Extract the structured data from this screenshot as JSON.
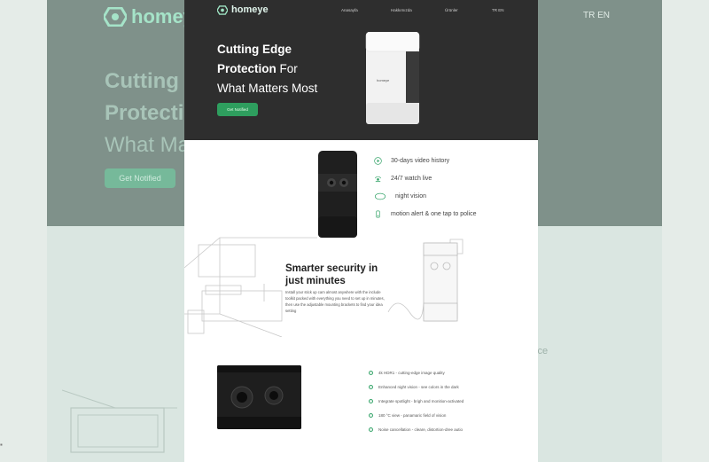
{
  "brand": {
    "logo_text": "homeye",
    "accent": "#2e9e5e",
    "accent_light": "#a5e3c8"
  },
  "background": {
    "language_switch": "TR EN",
    "hero_line1": "Cutting",
    "hero_line2": "Protecti",
    "hero_line3": "What Ma",
    "cta_label": "Get Notified",
    "side_text": "ice"
  },
  "nav": {
    "items": [
      "Anasayfa",
      "Hakkımızda",
      "Ürünler",
      "TR EN"
    ]
  },
  "hero": {
    "line1": "Cutting Edge",
    "line2_bold": "Protection",
    "line2_rest": " For",
    "line3": "What Matters Most",
    "cta_label": "Get Notified",
    "device_label": "homeye"
  },
  "features": [
    {
      "icon": "play-icon",
      "text": "30-days video history"
    },
    {
      "icon": "live-icon",
      "text": "24/7 watch live"
    },
    {
      "icon": "eye-icon",
      "text": "night vision"
    },
    {
      "icon": "alert-icon",
      "text": "motion alert & one tap to police"
    }
  ],
  "smarter": {
    "title_line1": "Smarter security in",
    "title_line2": "just minutes",
    "body": "Install your stick up cam almost anywhere with the include toolkit packed with everything you need to set up in minutes, then use the adjustable mounting brackets to find your idea setting"
  },
  "specs": [
    "4k HDR1 - cutting-edge image quality",
    "Enhanced night vision - see colors in the dark",
    "Integrate spotlight - brigh and monition-activated",
    "180 °C view - panamaric field of vision",
    "Noise cancellation - cleare, distortion-dree autio"
  ]
}
